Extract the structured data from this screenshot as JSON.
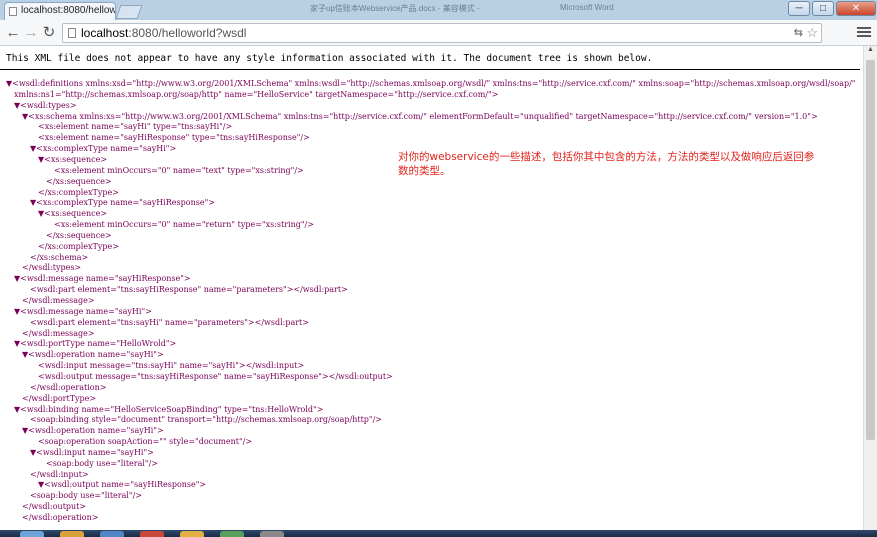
{
  "browser": {
    "tab_title": "localhost:8080/hellowo",
    "background_windows": [
      "家子up信账本Webservice产品.docx - 兼容模式 -",
      "Microsoft Word"
    ],
    "url_host": "localhost",
    "url_rest": ":8080/helloworld?wsdl",
    "window_controls": [
      "─",
      "□",
      "✕"
    ]
  },
  "xml_viewer": {
    "notice": "This XML file does not appear to have any style information associated with it. The document tree is shown below."
  },
  "annotation": "对你的webservice的一些描述，包括你其中包含的方法，方法的类型以及做响应后返回参数的类型。",
  "xml_lines": [
    "▼<wsdl:definitions xmlns:xsd=\"http://www.w3.org/2001/XMLSchema\" xmlns:wsdl=\"http://schemas.xmlsoap.org/wsdl/\" xmlns:tns=\"http://service.cxf.com/\" xmlns:soap=\"http://schemas.xmlsoap.org/wsdl/soap/\"",
    "xmlns:ns1=\"http://schemas.xmlsoap.org/soap/http\" name=\"HelloService\" targetNamespace=\"http://service.cxf.com/\">",
    "▼<wsdl:types>",
    "▼<xs:schema xmlns:xs=\"http://www.w3.org/2001/XMLSchema\" xmlns:tns=\"http://service.cxf.com/\" elementFormDefault=\"unqualified\" targetNamespace=\"http://service.cxf.com/\" version=\"1.0\">",
    "<xs:element name=\"sayHi\" type=\"tns:sayHi\"/>",
    "<xs:element name=\"sayHiResponse\" type=\"tns:sayHiResponse\"/>",
    "▼<xs:complexType name=\"sayHi\">",
    "▼<xs:sequence>",
    "<xs:element minOccurs=\"0\" name=\"text\" type=\"xs:string\"/>",
    "</xs:sequence>",
    "</xs:complexType>",
    "▼<xs:complexType name=\"sayHiResponse\">",
    "▼<xs:sequence>",
    "<xs:element minOccurs=\"0\" name=\"return\" type=\"xs:string\"/>",
    "</xs:sequence>",
    "</xs:complexType>",
    "</xs:schema>",
    "</wsdl:types>",
    "▼<wsdl:message name=\"sayHiResponse\">",
    "<wsdl:part element=\"tns:sayHiResponse\" name=\"parameters\"></wsdl:part>",
    "</wsdl:message>",
    "▼<wsdl:message name=\"sayHi\">",
    "<wsdl:part element=\"tns:sayHi\" name=\"parameters\"></wsdl:part>",
    "</wsdl:message>",
    "▼<wsdl:portType name=\"HelloWrold\">",
    "▼<wsdl:operation name=\"sayHi\">",
    "<wsdl:input message=\"tns:sayHi\" name=\"sayHi\"></wsdl:input>",
    "<wsdl:output message=\"tns:sayHiResponse\" name=\"sayHiResponse\"></wsdl:output>",
    "</wsdl:operation>",
    "</wsdl:portType>",
    "▼<wsdl:binding name=\"HelloServiceSoapBinding\" type=\"tns:HelloWrold\">",
    "<soap:binding style=\"document\" transport=\"http://schemas.xmlsoap.org/soap/http\"/>",
    "▼<wsdl:operation name=\"sayHi\">",
    "<soap:operation soapAction=\"\" style=\"document\"/>",
    "▼<wsdl:input name=\"sayHi\">",
    "<soap:body use=\"literal\"/>",
    "</wsdl:input>",
    "▼<wsdl:output name=\"sayHiResponse\">",
    "<soap:body use=\"literal\"/>",
    "</wsdl:output>",
    "</wsdl:operation>"
  ]
}
